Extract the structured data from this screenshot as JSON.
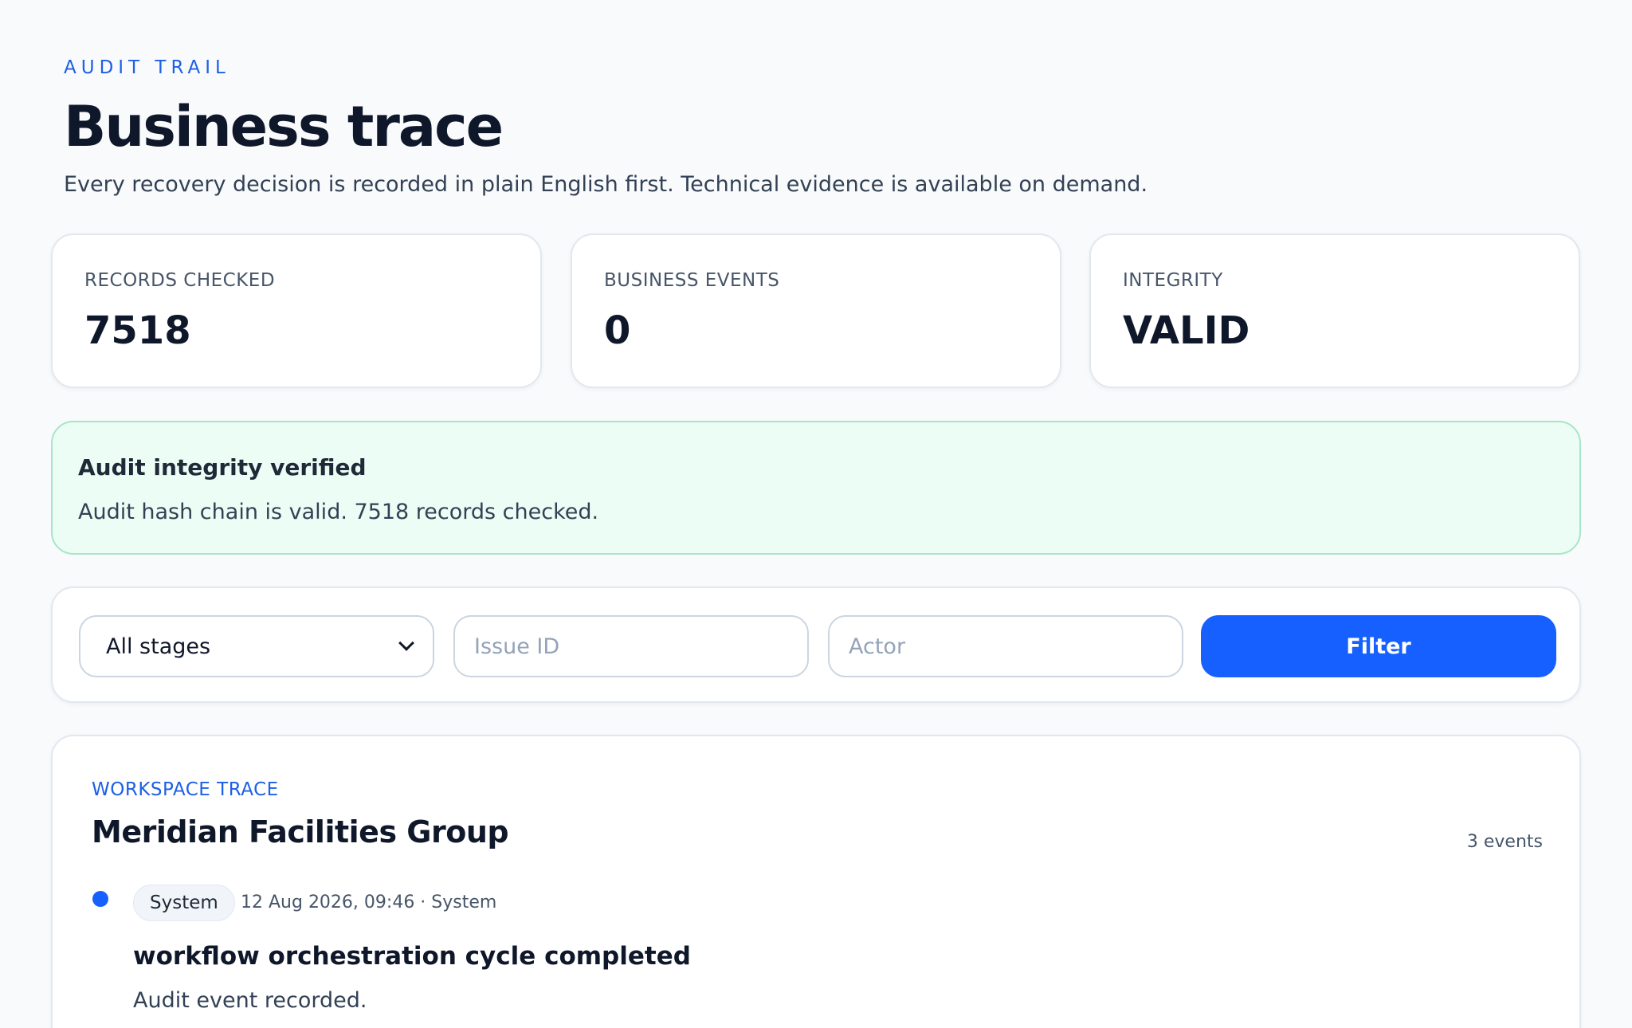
{
  "header": {
    "eyebrow": "AUDIT TRAIL",
    "title": "Business trace",
    "subtitle": "Every recovery decision is recorded in plain English first. Technical evidence is available on demand."
  },
  "stats": [
    {
      "label": "RECORDS CHECKED",
      "value": "7518"
    },
    {
      "label": "BUSINESS EVENTS",
      "value": "0"
    },
    {
      "label": "INTEGRITY",
      "value": "VALID"
    }
  ],
  "banner": {
    "title": "Audit integrity verified",
    "text": "Audit hash chain is valid. 7518 records checked."
  },
  "filters": {
    "stage_selected": "All stages",
    "issue_placeholder": "Issue ID",
    "actor_placeholder": "Actor",
    "filter_label": "Filter"
  },
  "trace": {
    "eyebrow": "WORKSPACE TRACE",
    "title": "Meridian Facilities Group",
    "count": "3 events",
    "events": [
      {
        "chip": "System",
        "meta": "12 Aug 2026, 09:46 · System",
        "title": "workflow orchestration cycle completed",
        "description": "Audit event recorded."
      }
    ]
  },
  "colors": {
    "accent": "#1660ff",
    "success_bg": "#ecfdf5",
    "success_border": "#a7e5c8"
  }
}
